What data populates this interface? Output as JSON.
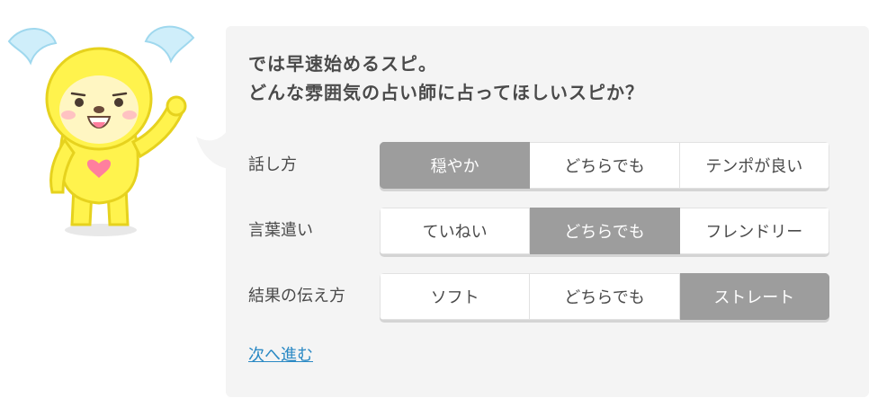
{
  "colors": {
    "panel_bg": "#f4f4f4",
    "selected_bg": "#9d9d9d",
    "link": "#2a89c4",
    "mascot_yellow": "#fff34d",
    "mascot_wing": "#cfeefa"
  },
  "mascot": {
    "icon": "yellow-mascot-character"
  },
  "prompt": {
    "line1": "では早速始めるスピ。",
    "line2": "どんな雰囲気の占い師に占ってほしいスピか？"
  },
  "rows": [
    {
      "label": "話し方",
      "options": [
        "穏やか",
        "どちらでも",
        "テンポが良い"
      ],
      "selected_index": 0
    },
    {
      "label": "言葉遣い",
      "options": [
        "ていねい",
        "どちらでも",
        "フレンドリー"
      ],
      "selected_index": 1
    },
    {
      "label": "結果の伝え方",
      "options": [
        "ソフト",
        "どちらでも",
        "ストレート"
      ],
      "selected_index": 2
    }
  ],
  "next_link": "次へ進む"
}
